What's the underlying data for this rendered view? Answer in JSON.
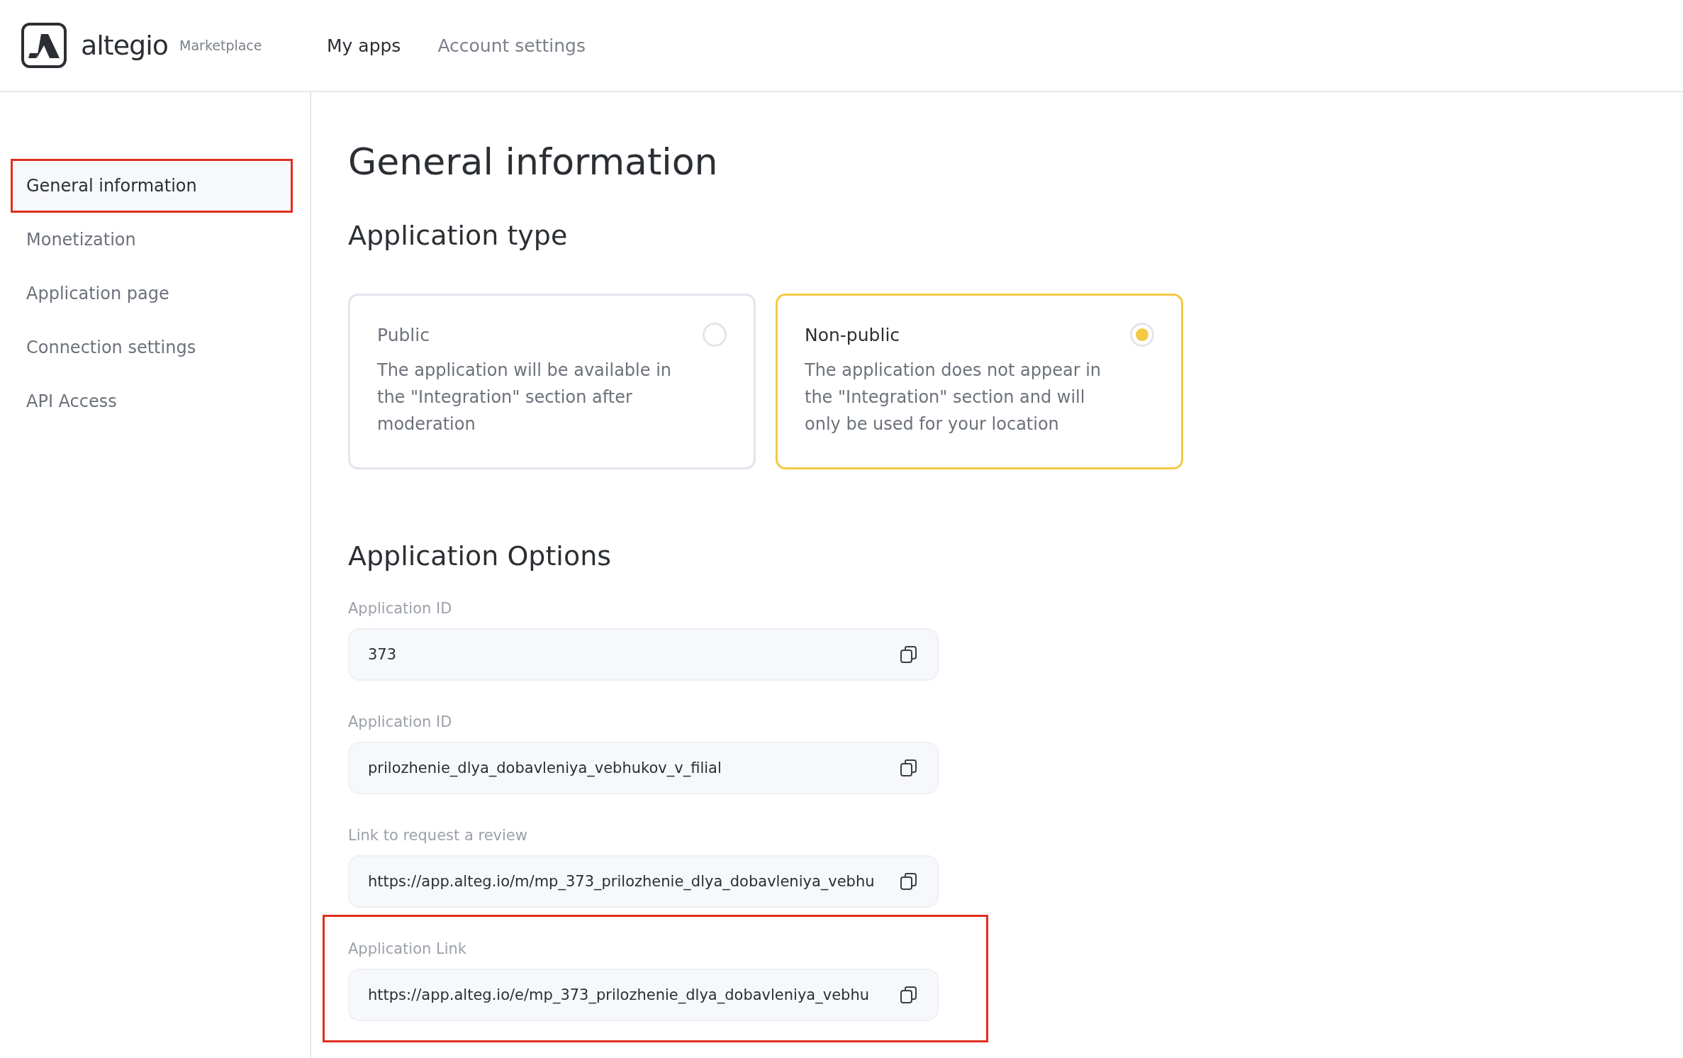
{
  "header": {
    "brand": "altegio",
    "product": "Marketplace",
    "nav": [
      {
        "label": "My apps",
        "selected": true
      },
      {
        "label": "Account settings",
        "selected": false
      }
    ]
  },
  "sidebar": {
    "items": [
      {
        "label": "General information",
        "selected": true,
        "highlighted": true
      },
      {
        "label": "Monetization",
        "selected": false,
        "highlighted": false
      },
      {
        "label": "Application page",
        "selected": false,
        "highlighted": false
      },
      {
        "label": "Connection settings",
        "selected": false,
        "highlighted": false
      },
      {
        "label": "API Access",
        "selected": false,
        "highlighted": false
      }
    ]
  },
  "main": {
    "title": "General information",
    "type_section": {
      "heading": "Application type",
      "options": [
        {
          "title": "Public",
          "description": "The application will be available in the \"Integration\" section after moderation",
          "selected": false
        },
        {
          "title": "Non-public",
          "description": "The application does not appear in the \"Integration\" section and will only be used for your location",
          "selected": true
        }
      ]
    },
    "options_section": {
      "heading": "Application Options",
      "fields": [
        {
          "label": "Application ID",
          "value": "373",
          "highlighted": false
        },
        {
          "label": "Application ID",
          "value": "prilozhenie_dlya_dobavleniya_vebhukov_v_filial",
          "highlighted": false
        },
        {
          "label": "Link to request a review",
          "value": "https://app.alteg.io/m/mp_373_prilozhenie_dlya_dobavleniya_vebhu",
          "highlighted": false
        },
        {
          "label": "Application Link",
          "value": "https://app.alteg.io/e/mp_373_prilozhenie_dlya_dobavleniya_vebhu",
          "highlighted": true
        }
      ]
    }
  }
}
